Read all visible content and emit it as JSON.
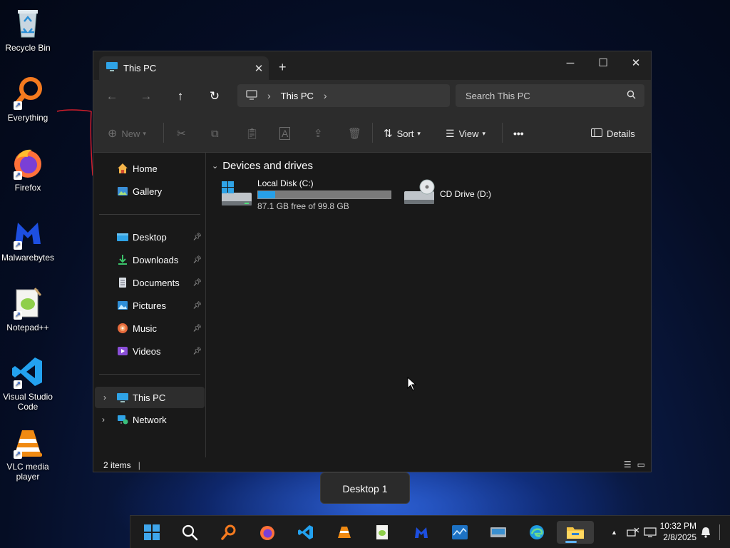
{
  "desktop": {
    "icons": [
      {
        "label": "Recycle Bin",
        "icon": "recycle-bin-icon"
      },
      {
        "label": "Everything",
        "icon": "everything-search-icon"
      },
      {
        "label": "Firefox",
        "icon": "firefox-icon"
      },
      {
        "label": "Malwarebytes",
        "icon": "malwarebytes-icon"
      },
      {
        "label": "Notepad++",
        "icon": "notepad-plus-plus-icon"
      },
      {
        "label": "Visual Studio Code",
        "icon": "vscode-icon"
      },
      {
        "label": "VLC media player",
        "icon": "vlc-icon"
      }
    ]
  },
  "window": {
    "tab_title": "This PC",
    "new_tab_symbol": "+",
    "controls": {
      "minimize": "─",
      "maximize": "☐",
      "close": "✕"
    },
    "address": {
      "segments": [
        "This PC"
      ]
    },
    "search_placeholder": "Search This PC",
    "toolbar": {
      "new_label": "New",
      "sort_label": "Sort",
      "view_label": "View",
      "more_label": "•••",
      "details_label": "Details"
    },
    "sidebar": {
      "top": [
        {
          "label": "Home",
          "icon": "home-icon"
        },
        {
          "label": "Gallery",
          "icon": "gallery-icon"
        }
      ],
      "pinned": [
        {
          "label": "Desktop",
          "icon": "desktop-folder-icon"
        },
        {
          "label": "Downloads",
          "icon": "downloads-folder-icon"
        },
        {
          "label": "Documents",
          "icon": "documents-folder-icon"
        },
        {
          "label": "Pictures",
          "icon": "pictures-folder-icon"
        },
        {
          "label": "Music",
          "icon": "music-folder-icon"
        },
        {
          "label": "Videos",
          "icon": "videos-folder-icon"
        }
      ],
      "locations": [
        {
          "label": "This PC",
          "icon": "this-pc-icon",
          "selected": true
        },
        {
          "label": "Network",
          "icon": "network-icon",
          "selected": false
        }
      ]
    },
    "content": {
      "group_header": "Devices and drives",
      "drives": [
        {
          "name": "Local Disk (C:)",
          "free_text": "87.1 GB free of 99.8 GB",
          "used_fraction": 0.127,
          "icon": "windows-drive-icon"
        },
        {
          "name": "CD Drive (D:)",
          "icon": "cd-drive-icon"
        }
      ]
    },
    "status": {
      "item_count": "2 items"
    }
  },
  "tooltip": {
    "label": "Desktop 1"
  },
  "taskbar": {
    "apps": [
      "start-icon",
      "search-icon",
      "everything-icon",
      "firefox-icon",
      "vscode-icon",
      "vlc-icon",
      "notepad-plus-plus-icon",
      "malwarebytes-icon",
      "task-manager-icon",
      "on-screen-keyboard-icon",
      "edge-icon",
      "file-explorer-icon"
    ],
    "active_app": "file-explorer-icon",
    "clock": {
      "time": "10:32 PM",
      "date": "2/8/2025"
    }
  },
  "colors": {
    "accent": "#27a0e8",
    "window_bg": "#191919",
    "toolbar_bg": "#2c2c2c"
  }
}
